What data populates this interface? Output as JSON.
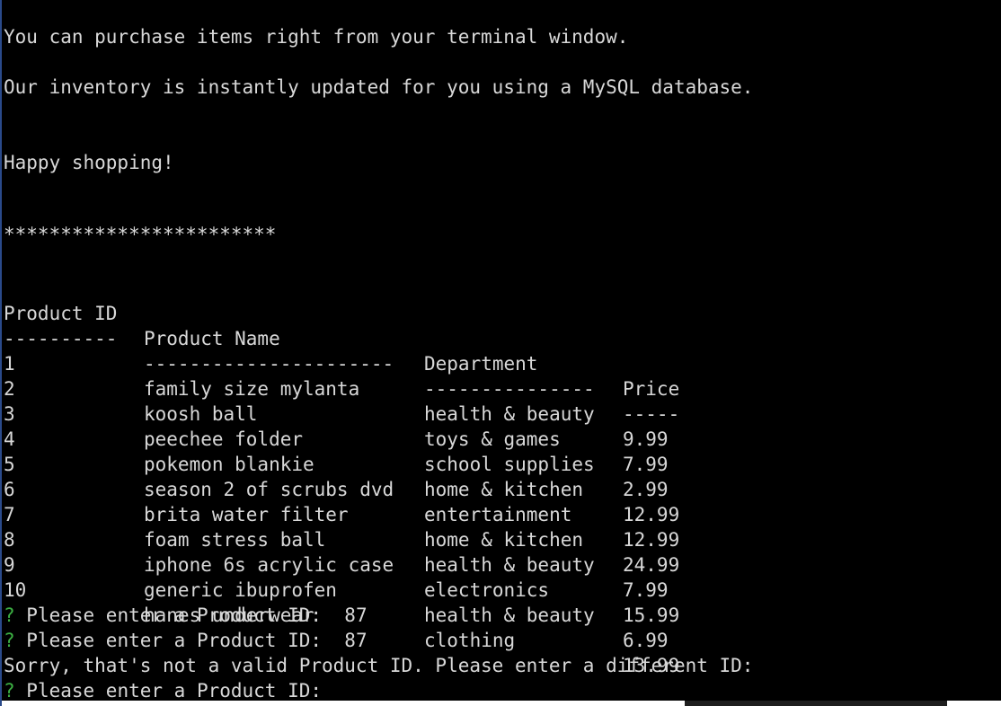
{
  "intro": {
    "line1": "You can purchase items right from your terminal window.",
    "line2": "Our inventory is instantly updated for you using a MySQL database.",
    "line3": "Happy shopping!",
    "stars": "************************"
  },
  "table": {
    "headers": [
      "Product ID",
      "Product Name",
      "Department",
      "Price"
    ],
    "dividers": [
      "----------",
      "----------------------",
      "---------------",
      "-----"
    ],
    "rows": [
      [
        "1",
        "family size mylanta",
        "health & beauty",
        "9.99"
      ],
      [
        "2",
        "koosh ball",
        "toys & games",
        "7.99"
      ],
      [
        "3",
        "peechee folder",
        "school supplies",
        "2.99"
      ],
      [
        "4",
        "pokemon blankie",
        "home & kitchen",
        "12.99"
      ],
      [
        "5",
        "season 2 of scrubs dvd",
        "entertainment",
        "12.99"
      ],
      [
        "6",
        "brita water filter",
        "home & kitchen",
        "24.99"
      ],
      [
        "7",
        "foam stress ball",
        "health & beauty",
        "7.99"
      ],
      [
        "8",
        "iphone 6s acrylic case",
        "electronics",
        "15.99"
      ],
      [
        "9",
        "generic ibuprofen",
        "health & beauty",
        "6.99"
      ],
      [
        "10",
        "hanes underwear",
        "clothing",
        "13.99"
      ]
    ]
  },
  "interaction": {
    "prompt_mark": "?",
    "prompt1_text": " Please enter a Product ID:  87",
    "prompt2_text": " Please enter a Product ID:  87",
    "error_text": "Sorry, that's not a valid Product ID. Please enter a different ID:",
    "prompt3_text": " Please enter a Product ID: "
  },
  "colors": {
    "background": "#000000",
    "text": "#d8d8d8",
    "prompt_mark": "#3cb043"
  }
}
